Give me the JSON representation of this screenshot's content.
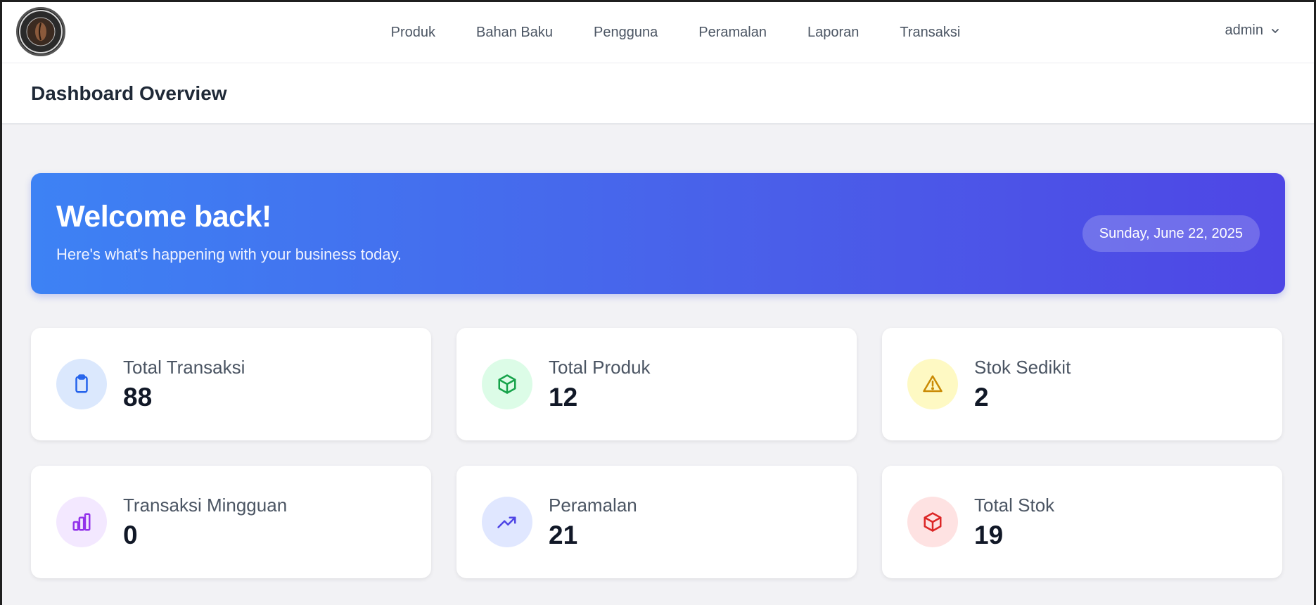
{
  "nav": {
    "links": [
      "Produk",
      "Bahan Baku",
      "Pengguna",
      "Peramalan",
      "Laporan",
      "Transaksi"
    ],
    "user": "admin"
  },
  "header": {
    "title": "Dashboard Overview"
  },
  "banner": {
    "title": "Welcome back!",
    "subtitle": "Here's what's happening with your business today.",
    "date": "Sunday, June 22, 2025"
  },
  "cards": [
    {
      "label": "Total Transaksi",
      "value": "88",
      "icon": "clipboard-icon",
      "color": "#2563eb",
      "bg": "#dbe8fd"
    },
    {
      "label": "Total Produk",
      "value": "12",
      "icon": "cube-icon",
      "color": "#16a34a",
      "bg": "#dcfce7"
    },
    {
      "label": "Stok Sedikit",
      "value": "2",
      "icon": "warning-icon",
      "color": "#ca8a04",
      "bg": "#fef9c3"
    },
    {
      "label": "Transaksi Mingguan",
      "value": "0",
      "icon": "bar-chart-icon",
      "color": "#9333ea",
      "bg": "#f3e8ff"
    },
    {
      "label": "Peramalan",
      "value": "21",
      "icon": "trending-up-icon",
      "color": "#4f46e5",
      "bg": "#e0e7ff"
    },
    {
      "label": "Total Stok",
      "value": "19",
      "icon": "box-icon",
      "color": "#dc2626",
      "bg": "#fee2e2"
    }
  ]
}
